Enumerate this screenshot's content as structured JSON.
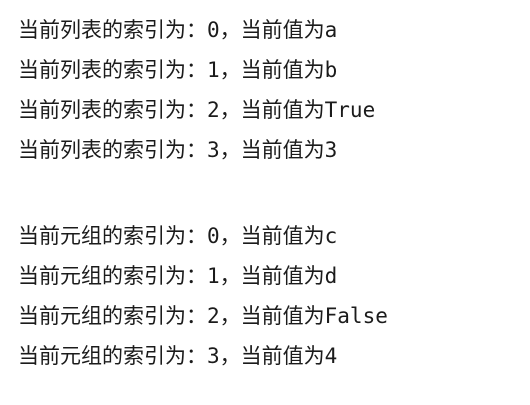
{
  "output": {
    "list_lines": [
      "当前列表的索引为：0，当前值为a",
      "当前列表的索引为：1，当前值为b",
      "当前列表的索引为：2，当前值为True",
      "当前列表的索引为：3，当前值为3"
    ],
    "tuple_lines": [
      "当前元组的索引为：0，当前值为c",
      "当前元组的索引为：1，当前值为d",
      "当前元组的索引为：2，当前值为False",
      "当前元组的索引为：3，当前值为4"
    ]
  }
}
